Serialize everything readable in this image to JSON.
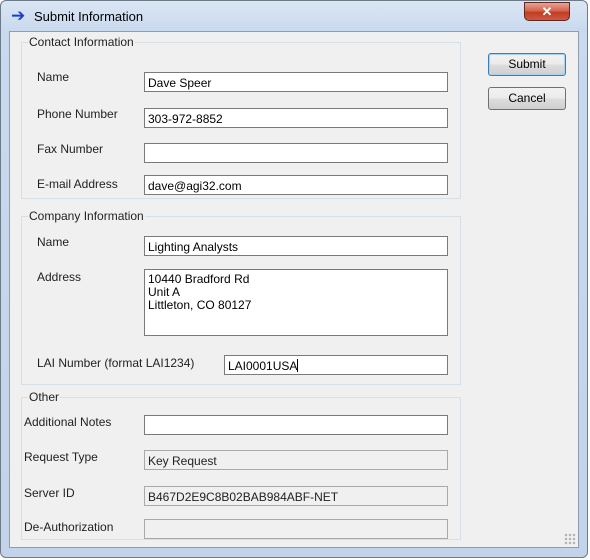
{
  "window": {
    "title": "Submit Information",
    "close_glyph": "✕",
    "title_icon": "blue-right-arrow-icon"
  },
  "buttons": {
    "submit": "Submit",
    "cancel": "Cancel"
  },
  "contact": {
    "legend": "Contact Information",
    "name_label": "Name",
    "name_value": "Dave Speer",
    "phone_label": "Phone Number",
    "phone_value": "303-972-8852",
    "fax_label": "Fax Number",
    "fax_value": "",
    "email_label": "E-mail Address",
    "email_value": "dave@agi32.com"
  },
  "company": {
    "legend": "Company Information",
    "name_label": "Name",
    "name_value": "Lighting Analysts",
    "address_label": "Address",
    "address_lines": [
      "10440 Bradford Rd",
      "Unit A",
      "Littleton, CO 80127"
    ],
    "lai_label": "LAI Number (format LAI1234)",
    "lai_value": "LAI0001USA"
  },
  "other": {
    "legend": "Other",
    "notes_label": "Additional Notes",
    "notes_value": "",
    "request_label": "Request Type",
    "request_value": "Key Request",
    "server_label": "Server ID",
    "server_value": "B467D2E9C8B02BAB984ABF-NET",
    "deauth_label": "De-Authorization",
    "deauth_value": ""
  },
  "colors": {
    "title_arrow": "#1540d0",
    "close_button": "#c13d24",
    "dialog_bg": "#f0f0f0"
  }
}
